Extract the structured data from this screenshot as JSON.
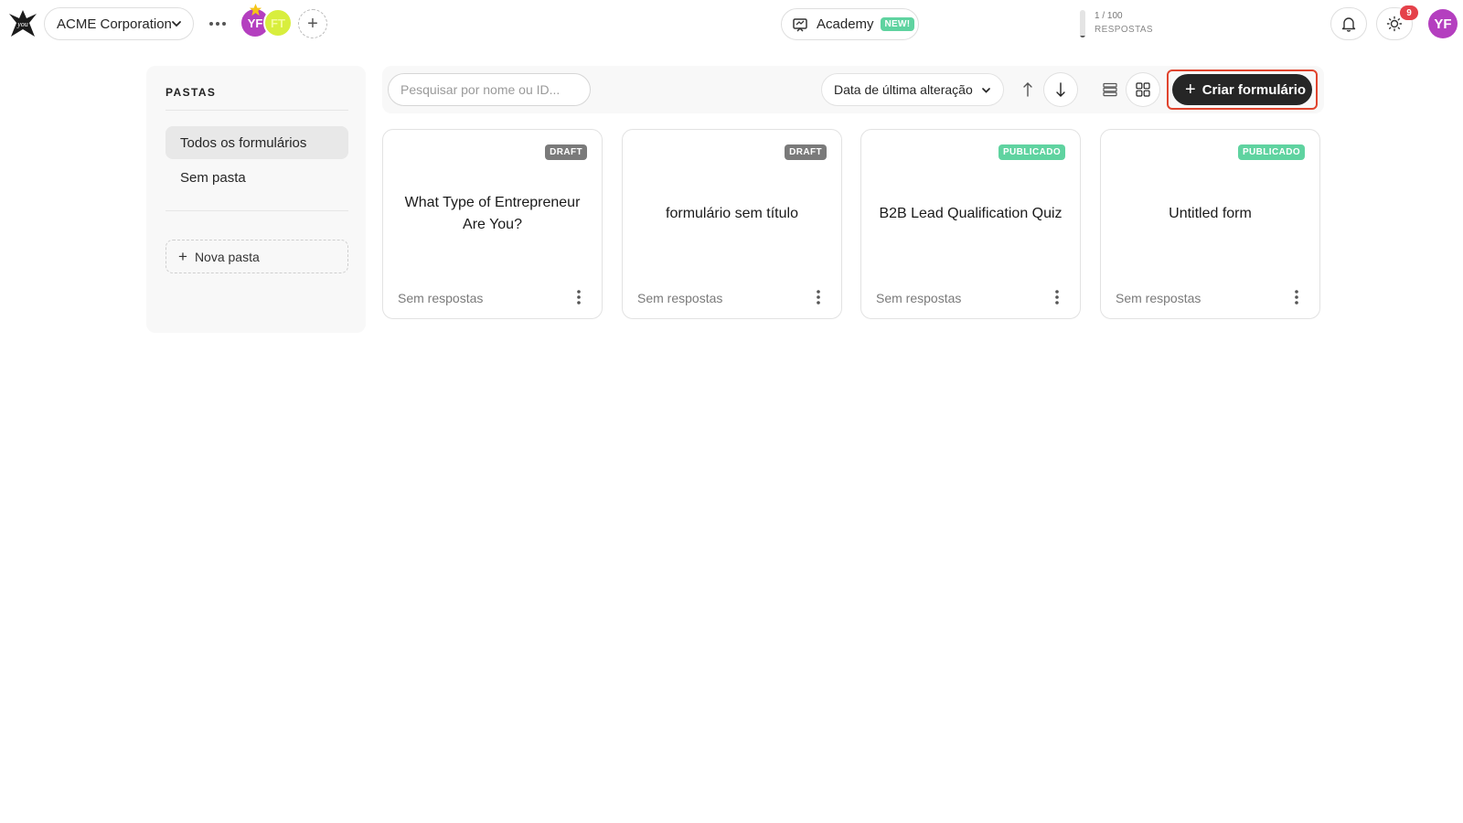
{
  "header": {
    "workspace_name": "ACME Corporation",
    "members": [
      {
        "initials": "YF",
        "color": "#b43fbf"
      },
      {
        "initials": "FT",
        "color": "#d8ee3d"
      }
    ],
    "academy_label": "Academy",
    "academy_badge": "NEW!",
    "responses_count": "1 / 100",
    "responses_label": "RESPOSTAS",
    "responses_used_fraction": 0.01,
    "notification_count": "9",
    "user_initials": "YF"
  },
  "sidebar": {
    "title": "PASTAS",
    "items": [
      {
        "label": "Todos os formulários",
        "active": true
      },
      {
        "label": "Sem pasta",
        "active": false
      }
    ],
    "new_folder_label": "Nova pasta"
  },
  "toolbar": {
    "search_placeholder": "Pesquisar por nome ou ID...",
    "sort_label": "Data de última alteração",
    "create_label": "Criar formulário"
  },
  "forms": [
    {
      "title": "What Type of Entrepreneur Are You?",
      "status": "DRAFT",
      "responses": "Sem respostas"
    },
    {
      "title": "formulário sem título",
      "status": "DRAFT",
      "responses": "Sem respostas"
    },
    {
      "title": "B2B Lead Qualification Quiz",
      "status": "PUBLICADO",
      "responses": "Sem respostas"
    },
    {
      "title": "Untitled form",
      "status": "PUBLICADO",
      "responses": "Sem respostas"
    }
  ],
  "colors": {
    "accent_dark": "#262626",
    "published": "#5fd3a0",
    "draft": "#7a7a7a",
    "highlight_outline": "#e0442e",
    "notification": "#e5414a",
    "avatar": "#b43fbf"
  }
}
